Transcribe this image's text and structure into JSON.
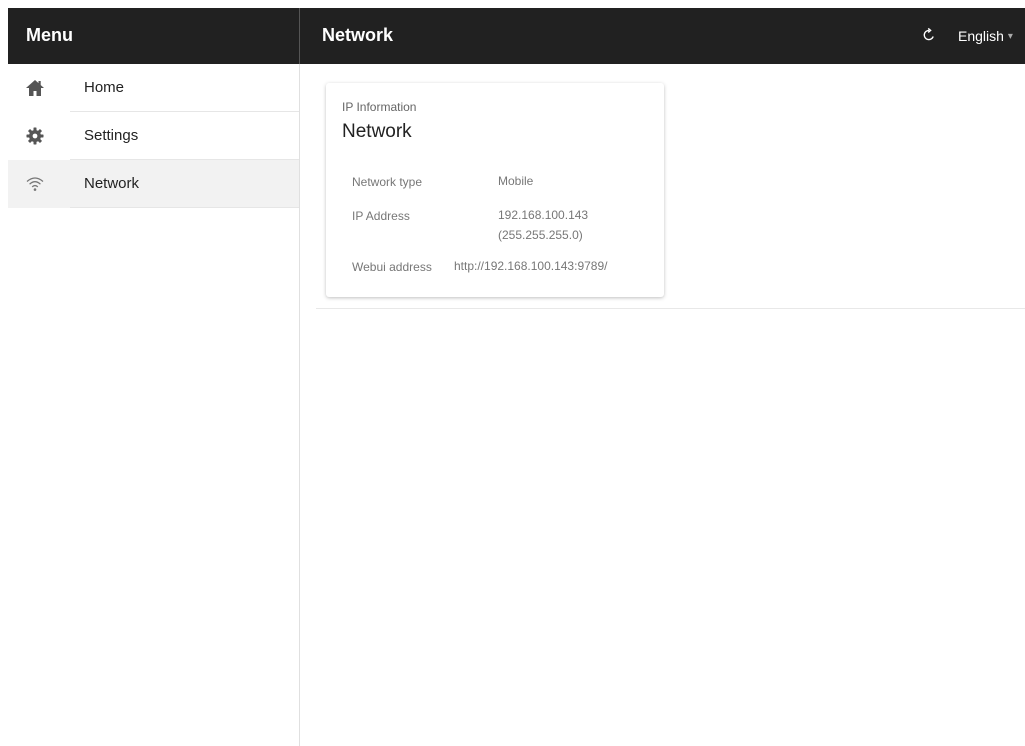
{
  "header": {
    "menu_title": "Menu",
    "page_title": "Network",
    "language": "English",
    "refresh_icon": "refresh-icon",
    "caret_icon": "chevron-down-icon"
  },
  "sidebar": {
    "items": [
      {
        "label": "Home",
        "icon": "home-icon",
        "active": false
      },
      {
        "label": "Settings",
        "icon": "gear-icon",
        "active": false
      },
      {
        "label": "Network",
        "icon": "wifi-icon",
        "active": true
      }
    ]
  },
  "card": {
    "subtitle": "IP Information",
    "title": "Network",
    "rows": [
      {
        "label": "Network type",
        "value": "Mobile"
      },
      {
        "label": "IP Address",
        "value": "192.168.100.143",
        "value2": "(255.255.255.0)"
      },
      {
        "label": "Webui address",
        "value": "http://192.168.100.143:9789/"
      }
    ]
  },
  "colors": {
    "appbar": "#212121",
    "active_item": "#f2f2f2"
  }
}
